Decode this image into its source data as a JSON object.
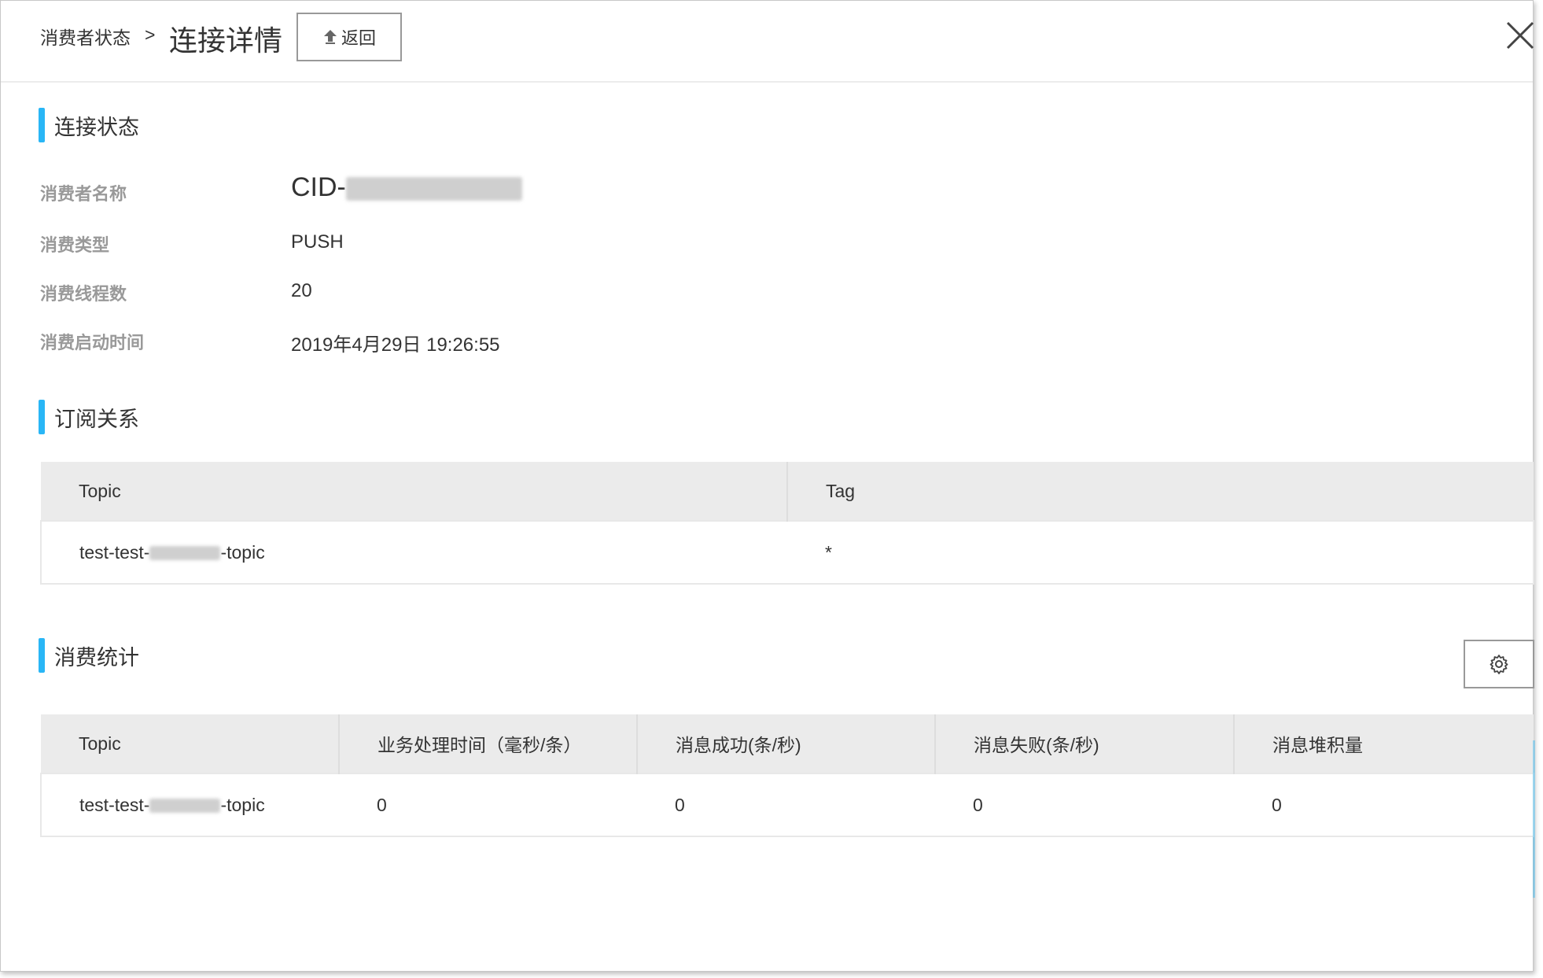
{
  "header": {
    "breadcrumb_parent": "消费者状态",
    "breadcrumb_separator": ">",
    "title": "连接详情",
    "back_label": "返回"
  },
  "connection": {
    "section_title": "连接状态",
    "fields": [
      {
        "label": "消费者名称",
        "value": "CID-"
      },
      {
        "label": "消费类型",
        "value": "PUSH"
      },
      {
        "label": "消费线程数",
        "value": "20"
      },
      {
        "label": "消费启动时间",
        "value": "2019年4月29日 19:26:55"
      }
    ]
  },
  "subscription": {
    "section_title": "订阅关系",
    "columns": [
      "Topic",
      "Tag"
    ],
    "rows": [
      {
        "topic_prefix": "test-test-",
        "topic_suffix": "-topic",
        "tag": "*"
      }
    ]
  },
  "stats": {
    "section_title": "消费统计",
    "columns": [
      "Topic",
      "业务处理时间（毫秒/条）",
      "消息成功(条/秒)",
      "消息失败(条/秒)",
      "消息堆积量"
    ],
    "rows": [
      {
        "topic_prefix": "test-test-",
        "topic_suffix": "-topic",
        "processing_time": "0",
        "success": "0",
        "failure": "0",
        "backlog": "0"
      }
    ]
  },
  "colors": {
    "accent": "#29b6f6",
    "header_bg": "#ebebeb"
  }
}
